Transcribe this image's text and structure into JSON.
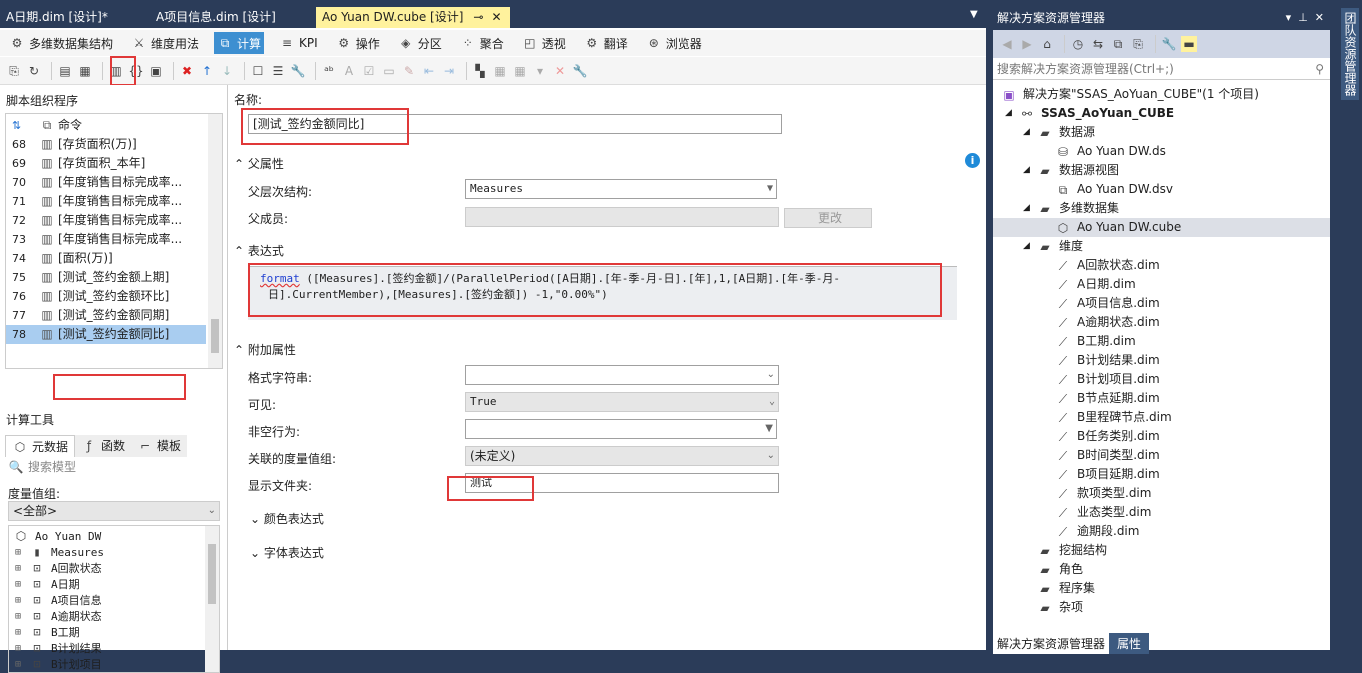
{
  "tabs": [
    {
      "label": "A日期.dim [设计]*"
    },
    {
      "label": "A项目信息.dim [设计]"
    },
    {
      "label": "Ao Yuan DW.cube [设计]"
    }
  ],
  "designer_tabs": [
    {
      "label": "多维数据集结构",
      "icon": "cube-structure-icon"
    },
    {
      "label": "维度用法",
      "icon": "dimension-usage-icon"
    },
    {
      "label": "计算",
      "icon": "calculations-icon"
    },
    {
      "label": "KPI",
      "icon": "kpi-icon"
    },
    {
      "label": "操作",
      "icon": "actions-icon"
    },
    {
      "label": "分区",
      "icon": "partitions-icon"
    },
    {
      "label": "聚合",
      "icon": "aggregations-icon"
    },
    {
      "label": "透视",
      "icon": "perspectives-icon"
    },
    {
      "label": "翻译",
      "icon": "translations-icon"
    },
    {
      "label": "浏览器",
      "icon": "browser-icon"
    }
  ],
  "script_organizer": {
    "title": "脚本组织程序",
    "header": "命令",
    "rows": [
      {
        "n": "68",
        "label": "[存货面积(万)]"
      },
      {
        "n": "69",
        "label": "[存货面积_本年]"
      },
      {
        "n": "70",
        "label": "[年度销售目标完成率..."
      },
      {
        "n": "71",
        "label": "[年度销售目标完成率..."
      },
      {
        "n": "72",
        "label": "[年度销售目标完成率..."
      },
      {
        "n": "73",
        "label": "[年度销售目标完成率..."
      },
      {
        "n": "74",
        "label": "[面积(万)]"
      },
      {
        "n": "75",
        "label": "[测试_签约金额上期]"
      },
      {
        "n": "76",
        "label": "[测试_签约金额环比]"
      },
      {
        "n": "77",
        "label": "[测试_签约金额同期]"
      },
      {
        "n": "78",
        "label": "[测试_签约金额同比]"
      }
    ]
  },
  "calc_tools": {
    "title": "计算工具",
    "tabs": [
      "元数据",
      "函数",
      "模板"
    ],
    "search_placeholder": "搜索模型",
    "measure_group_label": "度量值组:",
    "measure_group_value": "<全部>",
    "tree": [
      "Ao Yuan DW",
      "Measures",
      "A回款状态",
      "A日期",
      "A项目信息",
      "A逾期状态",
      "B工期",
      "B计划结果",
      "B计划项目"
    ]
  },
  "form": {
    "name_label": "名称:",
    "name_value": "[测试_签约金额同比]",
    "parent_section": "父属性",
    "parent_hierarchy_label": "父层次结构:",
    "parent_hierarchy_value": "Measures",
    "parent_member_label": "父成员:",
    "change_button": "更改",
    "expression_section": "表达式",
    "expression_keyword": "format",
    "expression_line1": " ([Measures].[签约金额]/(ParallelPeriod([A日期].[年-季-月-日].[年],1,[A日期].[年-季-月-",
    "expression_line2": "日].CurrentMember),[Measures].[签约金额]) -1,\"0.00%\")",
    "additional_section": "附加属性",
    "format_string_label": "格式字符串:",
    "format_string_value": "",
    "visible_label": "可见:",
    "visible_value": "True",
    "non_empty_label": "非空行为:",
    "non_empty_value": "",
    "measure_group_label": "关联的度量值组:",
    "measure_group_value": "(未定义)",
    "display_folder_label": "显示文件夹:",
    "display_folder_value": "测试",
    "color_section": "颜色表达式",
    "font_section": "字体表达式"
  },
  "solution_explorer": {
    "title": "解决方案资源管理器",
    "search_placeholder": "搜索解决方案资源管理器(Ctrl+;)",
    "items": [
      {
        "label": "解决方案\"SSAS_AoYuan_CUBE\"(1 个项目)",
        "level": 0,
        "icon": "solution-icon"
      },
      {
        "label": "SSAS_AoYuan_CUBE",
        "level": 1,
        "icon": "project-icon",
        "bold": true
      },
      {
        "label": "数据源",
        "level": 2,
        "icon": "folder-icon"
      },
      {
        "label": "Ao Yuan DW.ds",
        "level": 3,
        "icon": "datasource-icon"
      },
      {
        "label": "数据源视图",
        "level": 2,
        "icon": "folder-icon"
      },
      {
        "label": "Ao Yuan DW.dsv",
        "level": 3,
        "icon": "dsv-icon"
      },
      {
        "label": "多维数据集",
        "level": 2,
        "icon": "folder-icon"
      },
      {
        "label": "Ao Yuan DW.cube",
        "level": 3,
        "icon": "cube-icon",
        "selected": true
      },
      {
        "label": "维度",
        "level": 2,
        "icon": "folder-icon"
      },
      {
        "label": "A回款状态.dim",
        "level": 3,
        "icon": "dimension-icon"
      },
      {
        "label": "A日期.dim",
        "level": 3,
        "icon": "dimension-icon"
      },
      {
        "label": "A项目信息.dim",
        "level": 3,
        "icon": "dimension-icon"
      },
      {
        "label": "A逾期状态.dim",
        "level": 3,
        "icon": "dimension-icon"
      },
      {
        "label": "B工期.dim",
        "level": 3,
        "icon": "dimension-icon"
      },
      {
        "label": "B计划结果.dim",
        "level": 3,
        "icon": "dimension-icon"
      },
      {
        "label": "B计划项目.dim",
        "level": 3,
        "icon": "dimension-icon"
      },
      {
        "label": "B节点延期.dim",
        "level": 3,
        "icon": "dimension-icon"
      },
      {
        "label": "B里程碑节点.dim",
        "level": 3,
        "icon": "dimension-icon"
      },
      {
        "label": "B任务类别.dim",
        "level": 3,
        "icon": "dimension-icon"
      },
      {
        "label": "B时间类型.dim",
        "level": 3,
        "icon": "dimension-icon"
      },
      {
        "label": "B项目延期.dim",
        "level": 3,
        "icon": "dimension-icon"
      },
      {
        "label": "款项类型.dim",
        "level": 3,
        "icon": "dimension-icon"
      },
      {
        "label": "业态类型.dim",
        "level": 3,
        "icon": "dimension-icon"
      },
      {
        "label": "逾期段.dim",
        "level": 3,
        "icon": "dimension-icon"
      },
      {
        "label": "挖掘结构",
        "level": 2,
        "icon": "folder-icon"
      },
      {
        "label": "角色",
        "level": 2,
        "icon": "folder-icon"
      },
      {
        "label": "程序集",
        "level": 2,
        "icon": "folder-icon"
      },
      {
        "label": "杂项",
        "level": 2,
        "icon": "folder-icon"
      }
    ],
    "bottom_tabs": [
      "解决方案资源管理器",
      "属性"
    ]
  },
  "side_tab": "团队资源管理器",
  "colors": {
    "accent": "#3d8fd1",
    "active_tab": "#fff29d",
    "highlight": "#e03838",
    "frame": "#2b3c59"
  }
}
